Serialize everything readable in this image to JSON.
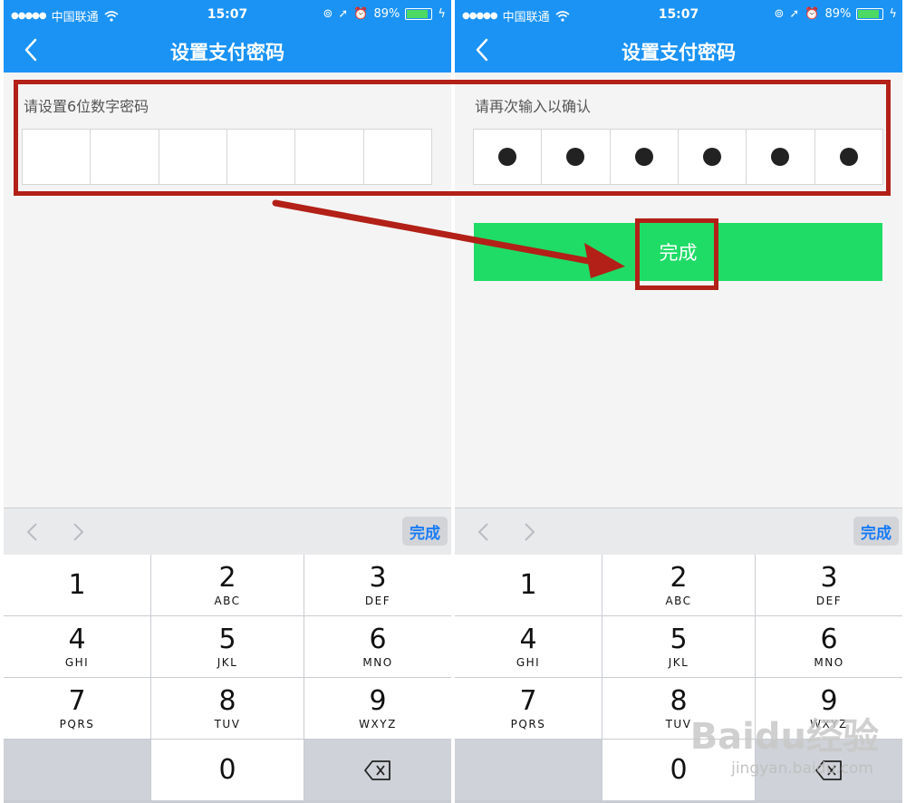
{
  "status_bar": {
    "carrier": "中国联通",
    "time": "15:07",
    "battery_percent": 89,
    "battery_label": "89%"
  },
  "navbar": {
    "title": "设置支付密码"
  },
  "left_screen": {
    "prompt": "请设置6位数字密码",
    "digits_entered": 0,
    "accessory_done_label": "完成"
  },
  "right_screen": {
    "prompt": "请再次输入以确认",
    "digits_entered": 6,
    "confirm_button_label": "完成",
    "accessory_done_label": "完成"
  },
  "keypad": {
    "keys": [
      {
        "num": "1",
        "letters": ""
      },
      {
        "num": "2",
        "letters": "ABC"
      },
      {
        "num": "3",
        "letters": "DEF"
      },
      {
        "num": "4",
        "letters": "GHI"
      },
      {
        "num": "5",
        "letters": "JKL"
      },
      {
        "num": "6",
        "letters": "MNO"
      },
      {
        "num": "7",
        "letters": "PQRS"
      },
      {
        "num": "8",
        "letters": "TUV"
      },
      {
        "num": "9",
        "letters": "WXYZ"
      },
      {
        "num": "",
        "letters": ""
      },
      {
        "num": "0",
        "letters": ""
      },
      {
        "num": "backspace",
        "letters": ""
      }
    ]
  },
  "watermark": {
    "brand": "Baidu经验",
    "url": "jingyan.baidu.com"
  },
  "colors": {
    "nav_blue": "#1a93f5",
    "confirm_green": "#1fdc66",
    "annotation_red": "#b22017",
    "accessory_done_text": "#1a7cf5"
  }
}
